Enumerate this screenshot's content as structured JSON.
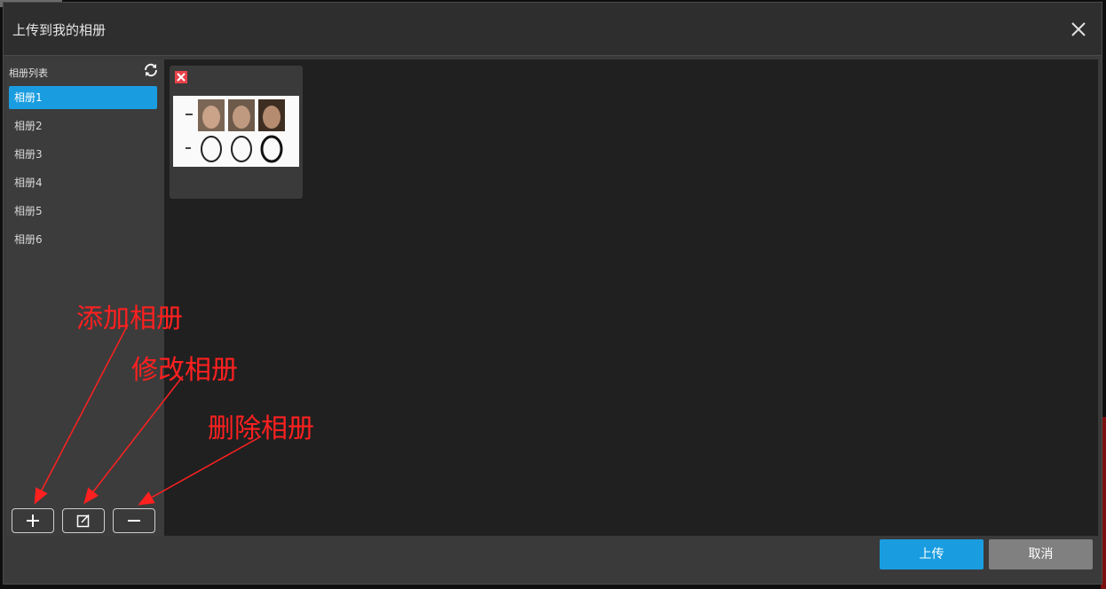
{
  "dialog": {
    "title": "上传到我的相册",
    "close_icon": "close-icon"
  },
  "sidebar": {
    "header": "相册列表",
    "refresh_icon": "refresh-icon",
    "albums": [
      {
        "label": "相册1",
        "selected": true
      },
      {
        "label": "相册2",
        "selected": false
      },
      {
        "label": "相册3",
        "selected": false
      },
      {
        "label": "相册4",
        "selected": false
      },
      {
        "label": "相册5",
        "selected": false
      },
      {
        "label": "相册6",
        "selected": false
      }
    ],
    "toolbar": {
      "add_icon": "plus-icon",
      "edit_icon": "edit-icon",
      "delete_icon": "minus-icon"
    }
  },
  "content": {
    "thumbnails": [
      {
        "remove_icon": "remove-icon"
      }
    ]
  },
  "footer": {
    "upload_label": "上传",
    "cancel_label": "取消"
  },
  "annotations": {
    "add": "添加相册",
    "edit": "修改相册",
    "delete": "删除相册"
  },
  "colors": {
    "accent": "#1a9de0",
    "annotation": "#ff2020",
    "remove": "#e8424a"
  }
}
